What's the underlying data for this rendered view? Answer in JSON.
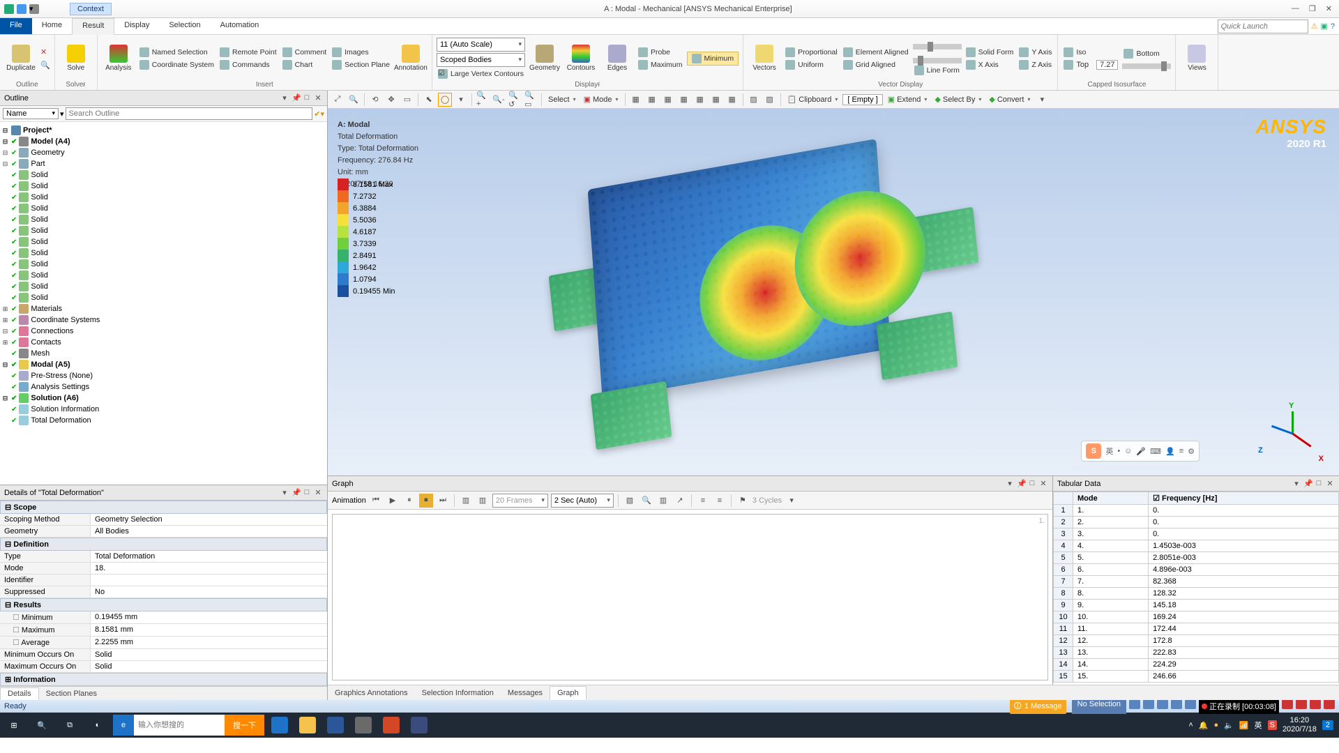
{
  "window": {
    "context_label": "Context",
    "title": "A : Modal - Mechanical [ANSYS Mechanical Enterprise]"
  },
  "tabs": {
    "file": "File",
    "home": "Home",
    "result": "Result",
    "display": "Display",
    "selection": "Selection",
    "automation": "Automation"
  },
  "ribbon": {
    "duplicate": "Duplicate",
    "solve": "Solve",
    "analysis": "Analysis",
    "insert": {
      "named": "Named Selection",
      "coord": "Coordinate System",
      "remote": "Remote Point",
      "commands": "Commands",
      "comment": "Comment",
      "chart": "Chart",
      "images": "Images",
      "section": "Section Plane",
      "annotation": "Annotation"
    },
    "display": {
      "scale": "11 (Auto Scale)",
      "scoped": "Scoped Bodies",
      "large": "Large Vertex Contours",
      "geometry": "Geometry",
      "contours": "Contours",
      "edges": "Edges",
      "probe": "Probe",
      "max": "Maximum",
      "min": "Minimum"
    },
    "vectors": {
      "label": "Vectors",
      "prop": "Proportional",
      "uni": "Uniform",
      "ea": "Element Aligned",
      "ga": "Grid Aligned",
      "lf": "Line Form",
      "sf": "Solid Form",
      "xa": "X Axis",
      "ya": "Y Axis",
      "za": "Z Axis"
    },
    "capped": {
      "iso": "Iso",
      "bottom": "Bottom",
      "top": "Top",
      "topval": "7.27"
    },
    "views": "Views",
    "grouplabels": {
      "outline": "Outline",
      "solve": "Solveғ",
      "insert": "Insert",
      "display": "Displayғ",
      "vector": "Vector Display",
      "capped": "Capped Isosurface"
    }
  },
  "quicklaunch_placeholder": "Quick Launch",
  "outline": {
    "title": "Outline",
    "filter": "Name",
    "search_placeholder": "Search Outline",
    "project": "Project*",
    "model": "Model (A4)",
    "geometry": "Geometry",
    "part": "Part",
    "solid": "Solid",
    "materials": "Materials",
    "coordsys": "Coordinate Systems",
    "connections": "Connections",
    "contacts": "Contacts",
    "mesh": "Mesh",
    "modal": "Modal (A5)",
    "prestress": "Pre-Stress (None)",
    "analysis_settings": "Analysis Settings",
    "solution": "Solution (A6)",
    "solinfo": "Solution Information",
    "totaldef": "Total Deformation"
  },
  "details": {
    "title": "Details of \"Total Deformation\"",
    "scope": "Scope",
    "scoping_method": "Scoping Method",
    "scoping_method_v": "Geometry Selection",
    "geometry": "Geometry",
    "geometry_v": "All Bodies",
    "definition": "Definition",
    "type": "Type",
    "type_v": "Total Deformation",
    "mode": "Mode",
    "mode_v": "18.",
    "identifier": "Identifier",
    "suppressed": "Suppressed",
    "suppressed_v": "No",
    "results": "Results",
    "minimum": "Minimum",
    "minimum_v": "0.19455 mm",
    "maximum": "Maximum",
    "maximum_v": "8.1581 mm",
    "average": "Average",
    "average_v": "2.2255 mm",
    "minocc": "Minimum Occurs On",
    "minocc_v": "Solid",
    "maxocc": "Maximum Occurs On",
    "maxocc_v": "Solid",
    "information": "Information",
    "tabs": {
      "details": "Details",
      "section": "Section Planes"
    }
  },
  "view": {
    "toolbar": {
      "select": "Select",
      "mode": "Mode",
      "clipboard": "Clipboard",
      "empty": "[ Empty ]",
      "extend": "Extend",
      "selectby": "Select By",
      "convert": "Convert"
    },
    "overlay": {
      "title": "A: Modal",
      "l1": "Total Deformation",
      "l2": "Type: Total Deformation",
      "l3": "Frequency: 276.84 Hz",
      "l4": "Unit: mm",
      "l5": "2020/7/18 16:20"
    },
    "ansys": {
      "brand": "ANSYS",
      "version": "2020 R1"
    },
    "legend": [
      {
        "c": "#d62222",
        "t": "8.1581 Max"
      },
      {
        "c": "#ef6a1f",
        "t": "7.2732"
      },
      {
        "c": "#f2a52a",
        "t": "6.3884"
      },
      {
        "c": "#f6e03c",
        "t": "5.5036"
      },
      {
        "c": "#b7e240",
        "t": "4.6187"
      },
      {
        "c": "#6fcf3c",
        "t": "3.7339"
      },
      {
        "c": "#35b36a",
        "t": "2.8491"
      },
      {
        "c": "#2ea8d8",
        "t": "1.9642"
      },
      {
        "c": "#2e7bce",
        "t": "1.0794"
      },
      {
        "c": "#1b4fa0",
        "t": "0.19455 Min"
      }
    ],
    "triad": {
      "x": "X",
      "y": "Y",
      "z": "Z"
    },
    "sogou": "英"
  },
  "graph": {
    "title": "Graph",
    "anim": "Animation",
    "frames": "20 Frames",
    "speed": "2 Sec (Auto)",
    "cycles": "3 Cycles"
  },
  "tabular": {
    "title": "Tabular Data",
    "mode_header": "Mode",
    "freq_header": "Frequency [Hz]",
    "rows": [
      {
        "n": "1",
        "m": "1.",
        "f": "0."
      },
      {
        "n": "2",
        "m": "2.",
        "f": "0."
      },
      {
        "n": "3",
        "m": "3.",
        "f": "0."
      },
      {
        "n": "4",
        "m": "4.",
        "f": "1.4503e-003"
      },
      {
        "n": "5",
        "m": "5.",
        "f": "2.8051e-003"
      },
      {
        "n": "6",
        "m": "6.",
        "f": "4.896e-003"
      },
      {
        "n": "7",
        "m": "7.",
        "f": "82.368"
      },
      {
        "n": "8",
        "m": "8.",
        "f": "128.32"
      },
      {
        "n": "9",
        "m": "9.",
        "f": "145.18"
      },
      {
        "n": "10",
        "m": "10.",
        "f": "169.24"
      },
      {
        "n": "11",
        "m": "11.",
        "f": "172.44"
      },
      {
        "n": "12",
        "m": "12.",
        "f": "172.8"
      },
      {
        "n": "13",
        "m": "13.",
        "f": "222.83"
      },
      {
        "n": "14",
        "m": "14.",
        "f": "224.29"
      },
      {
        "n": "15",
        "m": "15.",
        "f": "246.66"
      }
    ]
  },
  "infotabs": {
    "ga": "Graphics Annotations",
    "si": "Selection Information",
    "msg": "Messages",
    "graph": "Graph"
  },
  "status": {
    "ready": "Ready",
    "msg": "1 Message",
    "nosel": "No Selection",
    "rec": "正在录制 [00:03:08]"
  },
  "taskbar": {
    "search_placeholder": "输入你想搜的",
    "search_button": "搜一下",
    "time": "16:20",
    "date": "2020/7/18",
    "notif": "2"
  }
}
